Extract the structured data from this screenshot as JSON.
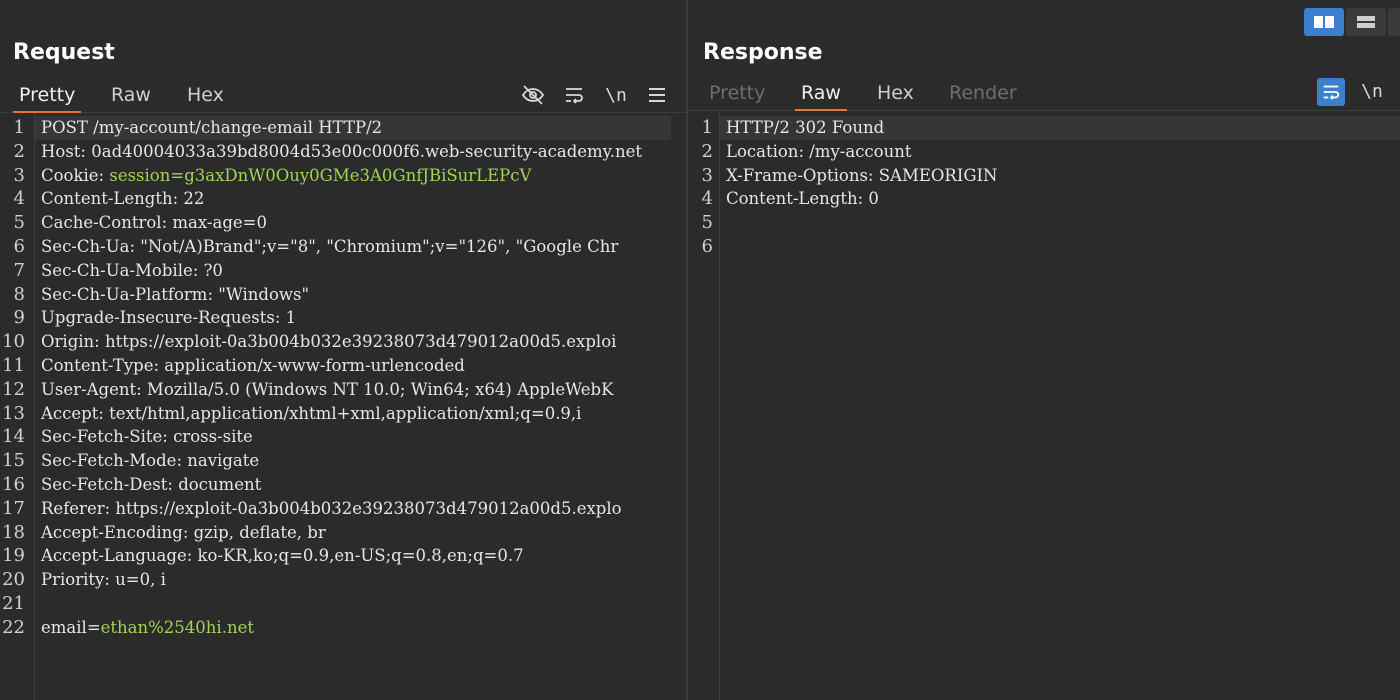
{
  "request": {
    "title": "Request",
    "tabs": [
      {
        "label": "Pretty",
        "state": "active"
      },
      {
        "label": "Raw",
        "state": "normal"
      },
      {
        "label": "Hex",
        "state": "normal"
      }
    ],
    "toolbar": {
      "newline_label": "\\n"
    },
    "lines": [
      {
        "num": "1",
        "key": "POST /my-account/change-email HTTP/2",
        "sep": "",
        "val": ""
      },
      {
        "num": "2",
        "key": "Host",
        "sep": ": ",
        "val": "0ad40004033a39bd8004d53e00c000f6.web-security-academy.net"
      },
      {
        "num": "3",
        "key": "Cookie",
        "sep": ": ",
        "val": "session=g3axDnW0Ouy0GMe3A0GnfJBiSurLEPcV"
      },
      {
        "num": "4",
        "key": "Content-Length",
        "sep": ": ",
        "val": "22"
      },
      {
        "num": "5",
        "key": "Cache-Control",
        "sep": ": ",
        "val": "max-age=0"
      },
      {
        "num": "6",
        "key": "Sec-Ch-Ua",
        "sep": ": ",
        "val": "\"Not/A)Brand\";v=\"8\", \"Chromium\";v=\"126\", \"Google Chr"
      },
      {
        "num": "7",
        "key": "Sec-Ch-Ua-Mobile",
        "sep": ": ",
        "val": "?0"
      },
      {
        "num": "8",
        "key": "Sec-Ch-Ua-Platform",
        "sep": ": ",
        "val": "\"Windows\""
      },
      {
        "num": "9",
        "key": "Upgrade-Insecure-Requests",
        "sep": ": ",
        "val": "1"
      },
      {
        "num": "10",
        "key": "Origin",
        "sep": ": ",
        "val": "https://exploit-0a3b004b032e39238073d479012a00d5.exploi"
      },
      {
        "num": "11",
        "key": "Content-Type",
        "sep": ": ",
        "val": "application/x-www-form-urlencoded"
      },
      {
        "num": "12",
        "key": "User-Agent",
        "sep": ": ",
        "val": "Mozilla/5.0 (Windows NT 10.0; Win64; x64) AppleWebK"
      },
      {
        "num": "13",
        "key": "Accept",
        "sep": ": ",
        "val": "text/html,application/xhtml+xml,application/xml;q=0.9,i"
      },
      {
        "num": "14",
        "key": "Sec-Fetch-Site",
        "sep": ": ",
        "val": "cross-site"
      },
      {
        "num": "15",
        "key": "Sec-Fetch-Mode",
        "sep": ": ",
        "val": "navigate"
      },
      {
        "num": "16",
        "key": "Sec-Fetch-Dest",
        "sep": ": ",
        "val": "document"
      },
      {
        "num": "17",
        "key": "Referer",
        "sep": ": ",
        "val": "https://exploit-0a3b004b032e39238073d479012a00d5.explo"
      },
      {
        "num": "18",
        "key": "Accept-Encoding",
        "sep": ": ",
        "val": "gzip, deflate, br"
      },
      {
        "num": "19",
        "key": "Accept-Language",
        "sep": ": ",
        "val": "ko-KR,ko;q=0.9,en-US;q=0.8,en;q=0.7"
      },
      {
        "num": "20",
        "key": "Priority",
        "sep": ": ",
        "val": "u=0, i"
      },
      {
        "num": "21",
        "key": "",
        "sep": "",
        "val": ""
      },
      {
        "num": "22",
        "key": "email",
        "sep": "=",
        "val": "ethan%2540hi.net"
      }
    ]
  },
  "response": {
    "title": "Response",
    "tabs": [
      {
        "label": "Pretty",
        "state": "dim"
      },
      {
        "label": "Raw",
        "state": "active"
      },
      {
        "label": "Hex",
        "state": "normal"
      },
      {
        "label": "Render",
        "state": "dim"
      }
    ],
    "toolbar": {
      "newline_label": "\\n"
    },
    "lines": [
      {
        "num": "1",
        "key": "HTTP/2 302 Found",
        "sep": "",
        "val": ""
      },
      {
        "num": "2",
        "key": "Location",
        "sep": ": ",
        "val": "/my-account"
      },
      {
        "num": "3",
        "key": "X-Frame-Options",
        "sep": ": ",
        "val": "SAMEORIGIN"
      },
      {
        "num": "4",
        "key": "Content-Length",
        "sep": ": ",
        "val": "0"
      },
      {
        "num": "5",
        "key": "",
        "sep": "",
        "val": ""
      },
      {
        "num": "6",
        "key": "",
        "sep": "",
        "val": ""
      }
    ]
  },
  "colors": {
    "accent_tab": "#e8753a",
    "selected_blue": "#3d7fcf",
    "cookie_value": "#a6d254"
  },
  "icons": [
    "hide-eye-icon",
    "wrap-lines-icon",
    "newline-icon",
    "menu-icon",
    "split-horizontal-icon",
    "split-vertical-icon"
  ]
}
